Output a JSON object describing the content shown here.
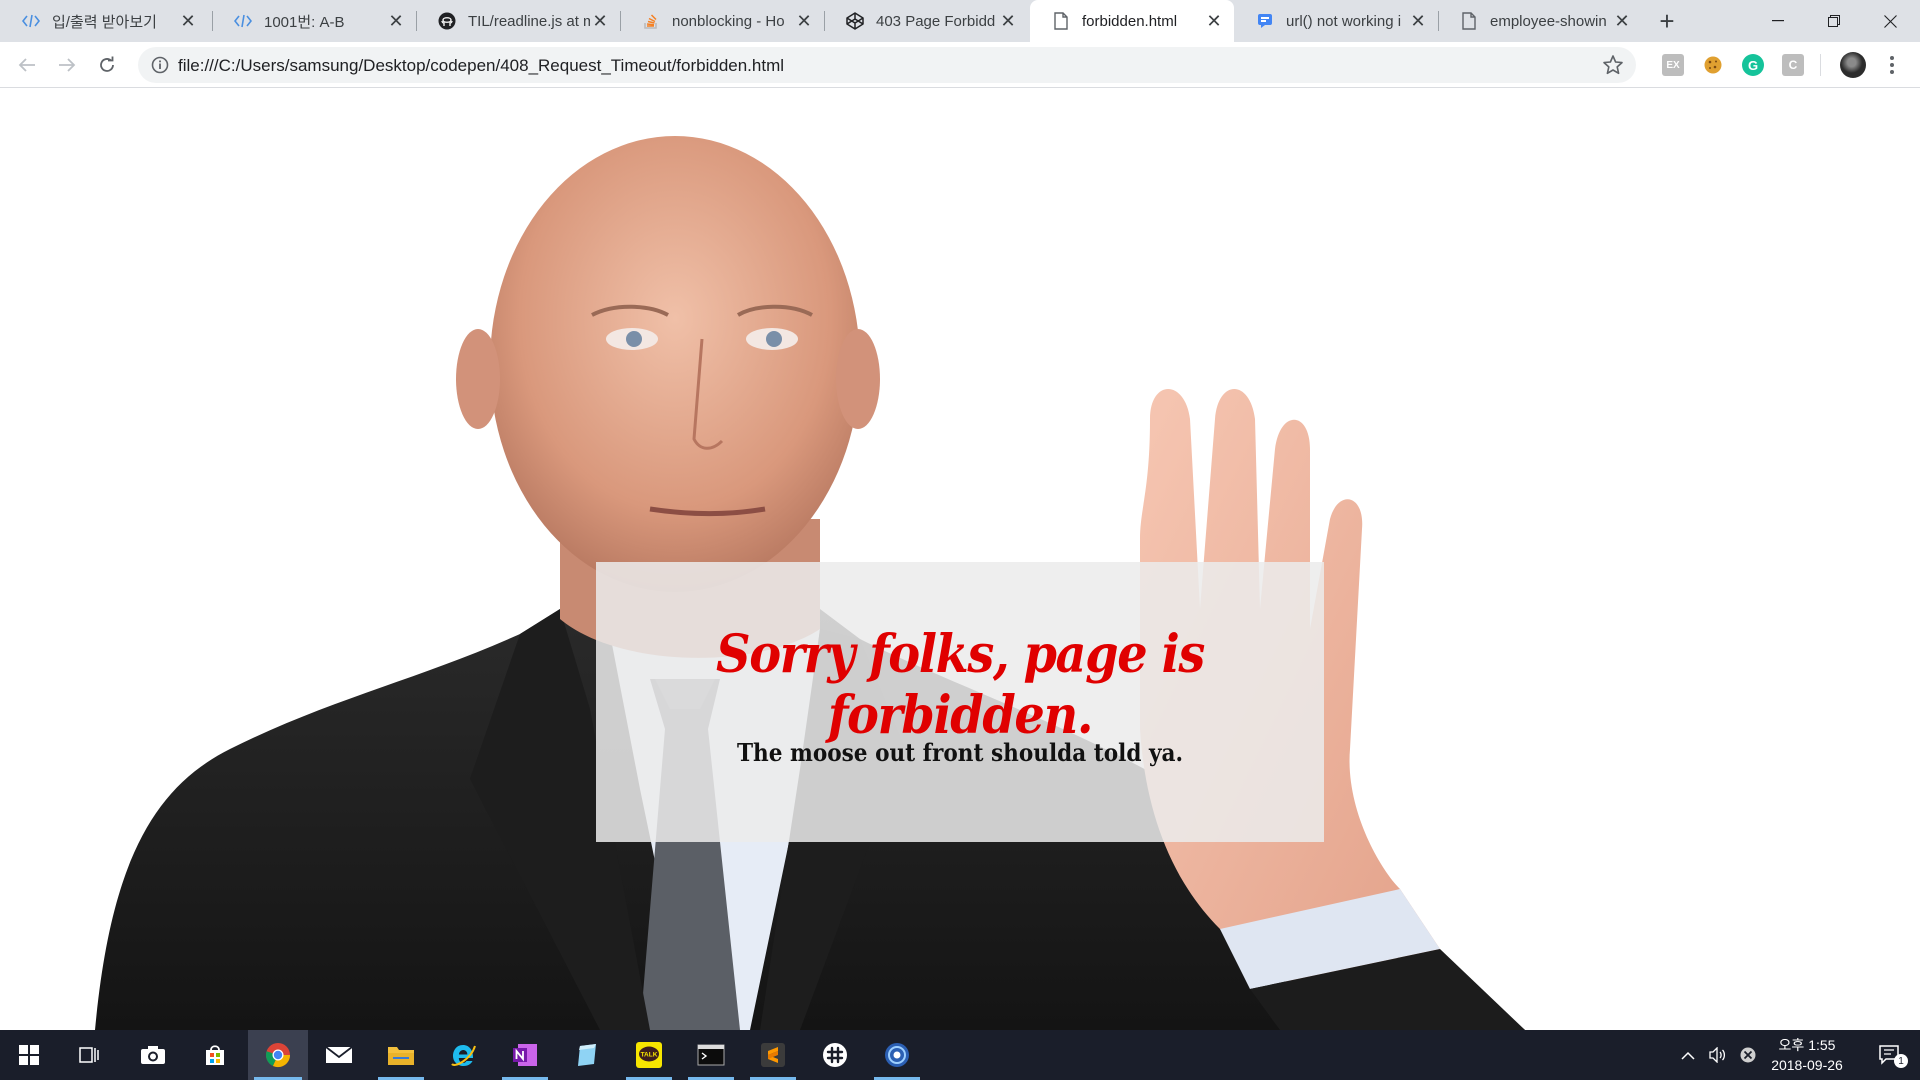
{
  "browser": {
    "tabs": [
      {
        "title": "입/출력 받아보기",
        "icon": "codepen-brackets-icon"
      },
      {
        "title": "1001번: A-B",
        "icon": "codepen-brackets-icon"
      },
      {
        "title": "TIL/readline.js at m",
        "icon": "github-icon"
      },
      {
        "title": "nonblocking - Ho",
        "icon": "stackoverflow-icon"
      },
      {
        "title": "403 Page Forbidd",
        "icon": "codepen-icon"
      },
      {
        "title": "forbidden.html",
        "icon": "file-icon",
        "active": true
      },
      {
        "title": "url() not working i",
        "icon": "chat-icon"
      },
      {
        "title": "employee-showin",
        "icon": "file-icon"
      }
    ],
    "new_tab_label": "+",
    "url": "file:///C:/Users/samsung/Desktop/codepen/408_Request_Timeout/forbidden.html",
    "extensions": [
      {
        "name": "ex-extension-icon",
        "label": "EX",
        "color": "#bdbdbd"
      },
      {
        "name": "cookie-extension-icon",
        "label": "",
        "color": "#e0a030"
      },
      {
        "name": "grammarly-extension-icon",
        "label": "G",
        "color": "#15c39a"
      },
      {
        "name": "c-extension-icon",
        "label": "C",
        "color": "#bdbdbd"
      }
    ]
  },
  "page": {
    "headline": "Sorry folks, page is forbidden.",
    "subline": "The moose out front shoulda told ya.",
    "headline_color": "#e00000"
  },
  "taskbar": {
    "apps": [
      {
        "name": "start-button-icon"
      },
      {
        "name": "task-view-icon"
      },
      {
        "name": "camera-app-icon"
      },
      {
        "name": "store-app-icon"
      },
      {
        "name": "chrome-app-icon",
        "active": true
      },
      {
        "name": "mail-app-icon"
      },
      {
        "name": "file-explorer-icon"
      },
      {
        "name": "internet-explorer-icon"
      },
      {
        "name": "onenote-app-icon"
      },
      {
        "name": "notepad-app-icon"
      },
      {
        "name": "kakaotalk-app-icon"
      },
      {
        "name": "terminal-app-icon"
      },
      {
        "name": "sublime-text-app-icon"
      },
      {
        "name": "slack-app-icon"
      },
      {
        "name": "app-icon"
      }
    ],
    "tray": {
      "time": "오후 1:55",
      "date": "2018-09-26",
      "notification_count": "1"
    }
  }
}
